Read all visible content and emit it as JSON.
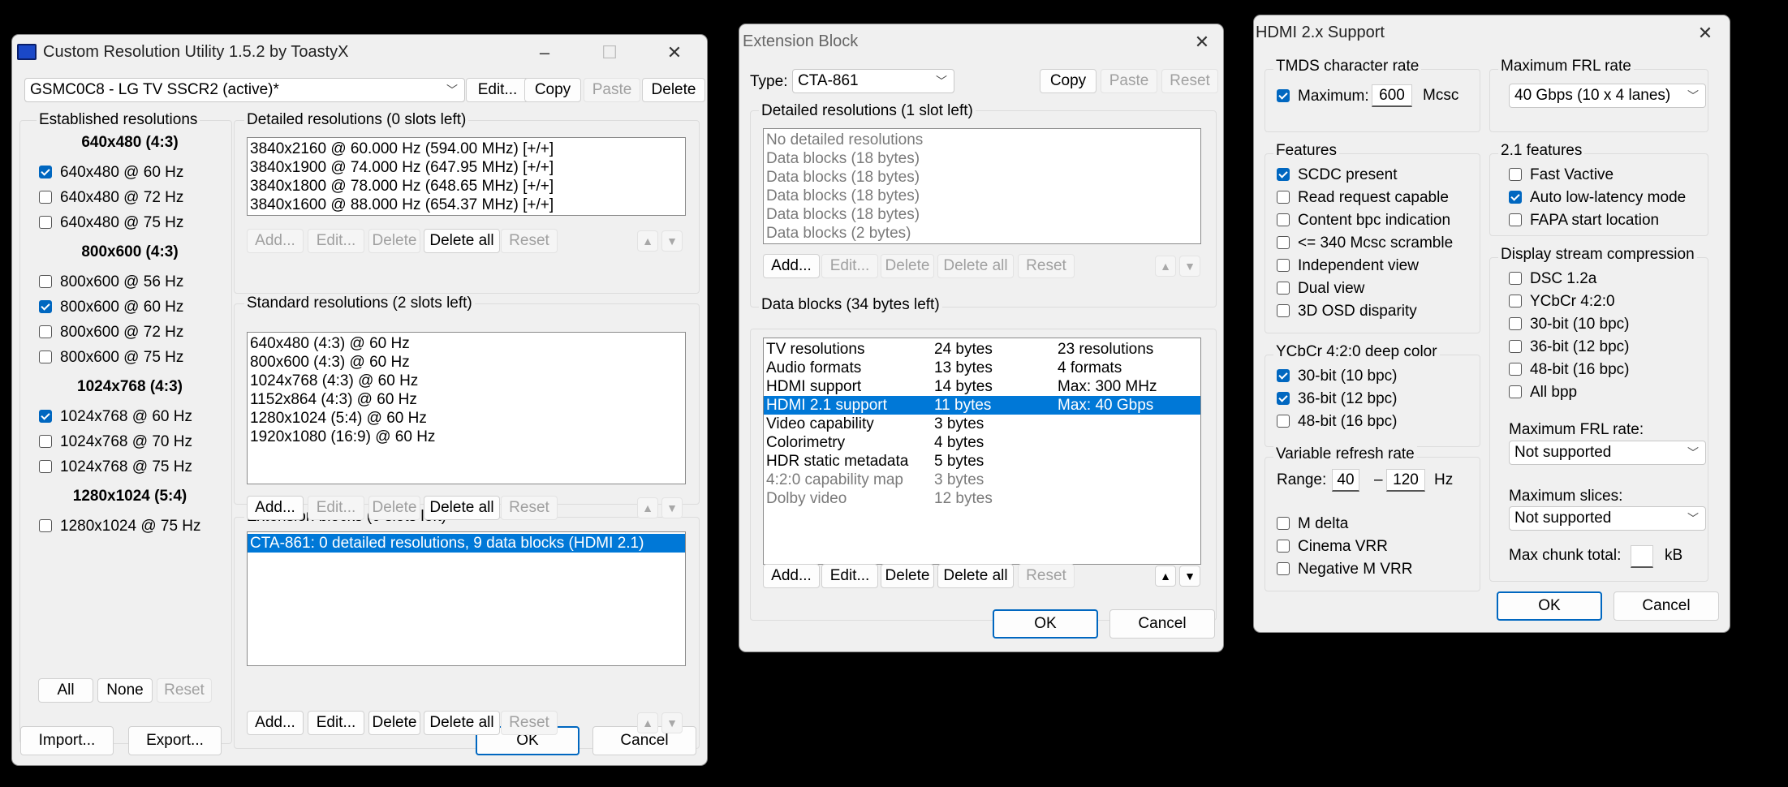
{
  "cru": {
    "title": "Custom Resolution Utility 1.5.2 by ToastyX",
    "monitor": "GSMC0C8 - LG TV SSCR2 (active)*",
    "top_buttons": {
      "edit": "Edit...",
      "copy": "Copy",
      "paste": "Paste",
      "delete": "Delete"
    },
    "established": {
      "label": "Established resolutions",
      "groups": [
        {
          "header": "640x480 (4:3)",
          "items": [
            {
              "label": "640x480 @ 60 Hz",
              "checked": true
            },
            {
              "label": "640x480 @ 72 Hz",
              "checked": false
            },
            {
              "label": "640x480 @ 75 Hz",
              "checked": false
            }
          ]
        },
        {
          "header": "800x600 (4:3)",
          "items": [
            {
              "label": "800x600 @ 56 Hz",
              "checked": false
            },
            {
              "label": "800x600 @ 60 Hz",
              "checked": true
            },
            {
              "label": "800x600 @ 72 Hz",
              "checked": false
            },
            {
              "label": "800x600 @ 75 Hz",
              "checked": false
            }
          ]
        },
        {
          "header": "1024x768 (4:3)",
          "items": [
            {
              "label": "1024x768 @ 60 Hz",
              "checked": true
            },
            {
              "label": "1024x768 @ 70 Hz",
              "checked": false
            },
            {
              "label": "1024x768 @ 75 Hz",
              "checked": false
            }
          ]
        },
        {
          "header": "1280x1024 (5:4)",
          "items": [
            {
              "label": "1280x1024 @ 75 Hz",
              "checked": false
            }
          ]
        }
      ],
      "buttons": {
        "all": "All",
        "none": "None",
        "reset": "Reset"
      }
    },
    "detailed": {
      "label": "Detailed resolutions (0 slots left)",
      "items": [
        "3840x2160 @ 60.000 Hz (594.00 MHz) [+/+]",
        "3840x1900 @ 74.000 Hz (647.95 MHz) [+/+]",
        "3840x1800 @ 78.000 Hz (648.65 MHz) [+/+]",
        "3840x1600 @ 88.000 Hz (654.37 MHz) [+/+]"
      ]
    },
    "standard": {
      "label": "Standard resolutions (2 slots left)",
      "items": [
        "640x480 (4:3) @ 60 Hz",
        "800x600 (4:3) @ 60 Hz",
        "1024x768 (4:3) @ 60 Hz",
        "1152x864 (4:3) @ 60 Hz",
        "1280x1024 (5:4) @ 60 Hz",
        "1920x1080 (16:9) @ 60 Hz"
      ]
    },
    "extension": {
      "label": "Extension blocks (6 slots left)",
      "items": [
        "CTA-861: 0 detailed resolutions, 9 data blocks (HDMI 2.1)"
      ]
    },
    "list_buttons": {
      "add": "Add...",
      "edit": "Edit...",
      "delete": "Delete",
      "delete_all": "Delete all",
      "reset": "Reset"
    },
    "bottom": {
      "import": "Import...",
      "export": "Export...",
      "ok": "OK",
      "cancel": "Cancel"
    }
  },
  "ext": {
    "title": "Extension Block",
    "type_label": "Type:",
    "type_value": "CTA-861",
    "top_buttons": {
      "copy": "Copy",
      "paste": "Paste",
      "reset": "Reset"
    },
    "detailed": {
      "label": "Detailed resolutions (1 slot left)",
      "items": [
        "No detailed resolutions",
        "Data blocks (18 bytes)",
        "Data blocks (18 bytes)",
        "Data blocks (18 bytes)",
        "Data blocks (18 bytes)",
        "Data blocks (2 bytes)"
      ]
    },
    "data_blocks": {
      "label": "Data blocks (34 bytes left)",
      "rows": [
        {
          "name": "TV resolutions",
          "size": "24 bytes",
          "info": "23 resolutions",
          "dim": false,
          "sel": false
        },
        {
          "name": "Audio formats",
          "size": "13 bytes",
          "info": "4 formats",
          "dim": false,
          "sel": false
        },
        {
          "name": "HDMI support",
          "size": "14 bytes",
          "info": "Max: 300 MHz",
          "dim": false,
          "sel": false
        },
        {
          "name": "HDMI 2.1 support",
          "size": "11 bytes",
          "info": "Max: 40 Gbps",
          "dim": false,
          "sel": true
        },
        {
          "name": "Video capability",
          "size": "3 bytes",
          "info": "",
          "dim": false,
          "sel": false
        },
        {
          "name": "Colorimetry",
          "size": "4 bytes",
          "info": "",
          "dim": false,
          "sel": false
        },
        {
          "name": "HDR static metadata",
          "size": "5 bytes",
          "info": "",
          "dim": false,
          "sel": false
        },
        {
          "name": "4:2:0 capability map",
          "size": "3 bytes",
          "info": "",
          "dim": true,
          "sel": false
        },
        {
          "name": "Dolby video",
          "size": "12 bytes",
          "info": "",
          "dim": true,
          "sel": false
        }
      ]
    },
    "list_buttons": {
      "add": "Add...",
      "edit": "Edit...",
      "delete": "Delete",
      "delete_all": "Delete all",
      "reset": "Reset"
    },
    "bottom": {
      "ok": "OK",
      "cancel": "Cancel"
    }
  },
  "hdmi": {
    "title": "HDMI 2.x Support",
    "tmds": {
      "label": "TMDS character rate",
      "max_label": "Maximum:",
      "max_checked": true,
      "value": "600",
      "unit": "Mcsc"
    },
    "max_frl": {
      "label": "Maximum FRL rate",
      "value": "40 Gbps (10 x 4 lanes)"
    },
    "features": {
      "label": "Features",
      "items": [
        {
          "label": "SCDC present",
          "checked": true
        },
        {
          "label": "Read request capable",
          "checked": false
        },
        {
          "label": "Content bpc indication",
          "checked": false
        },
        {
          "label": "<= 340 Mcsc scramble",
          "checked": false
        },
        {
          "label": "Independent view",
          "checked": false
        },
        {
          "label": "Dual view",
          "checked": false
        },
        {
          "label": "3D OSD disparity",
          "checked": false
        }
      ]
    },
    "features21": {
      "label": "2.1 features",
      "items": [
        {
          "label": "Fast Vactive",
          "checked": false
        },
        {
          "label": "Auto low-latency mode",
          "checked": true
        },
        {
          "label": "FAPA start location",
          "checked": false
        }
      ]
    },
    "ycbcr": {
      "label": "YCbCr 4:2:0 deep color",
      "items": [
        {
          "label": "30-bit (10 bpc)",
          "checked": true
        },
        {
          "label": "36-bit (12 bpc)",
          "checked": true
        },
        {
          "label": "48-bit (16 bpc)",
          "checked": false
        }
      ]
    },
    "dsc": {
      "label": "Display stream compression",
      "items": [
        {
          "label": "DSC 1.2a",
          "checked": false
        },
        {
          "label": "YCbCr 4:2:0",
          "checked": false
        },
        {
          "label": "30-bit (10 bpc)",
          "checked": false
        },
        {
          "label": "36-bit (12 bpc)",
          "checked": false
        },
        {
          "label": "48-bit (16 bpc)",
          "checked": false
        },
        {
          "label": "All bpp",
          "checked": false
        }
      ],
      "frl_label": "Maximum FRL rate:",
      "frl_value": "Not supported",
      "slices_label": "Maximum slices:",
      "slices_value": "Not supported",
      "chunk_label": "Max chunk total:",
      "chunk_value": "",
      "chunk_unit": "kB"
    },
    "vrr": {
      "label": "Variable refresh rate",
      "range_label": "Range:",
      "min": "40",
      "dash": "–",
      "max": "120",
      "unit": "Hz",
      "items": [
        {
          "label": "M delta",
          "checked": false
        },
        {
          "label": "Cinema VRR",
          "checked": false
        },
        {
          "label": "Negative M VRR",
          "checked": false
        }
      ]
    },
    "bottom": {
      "ok": "OK",
      "cancel": "Cancel"
    }
  }
}
